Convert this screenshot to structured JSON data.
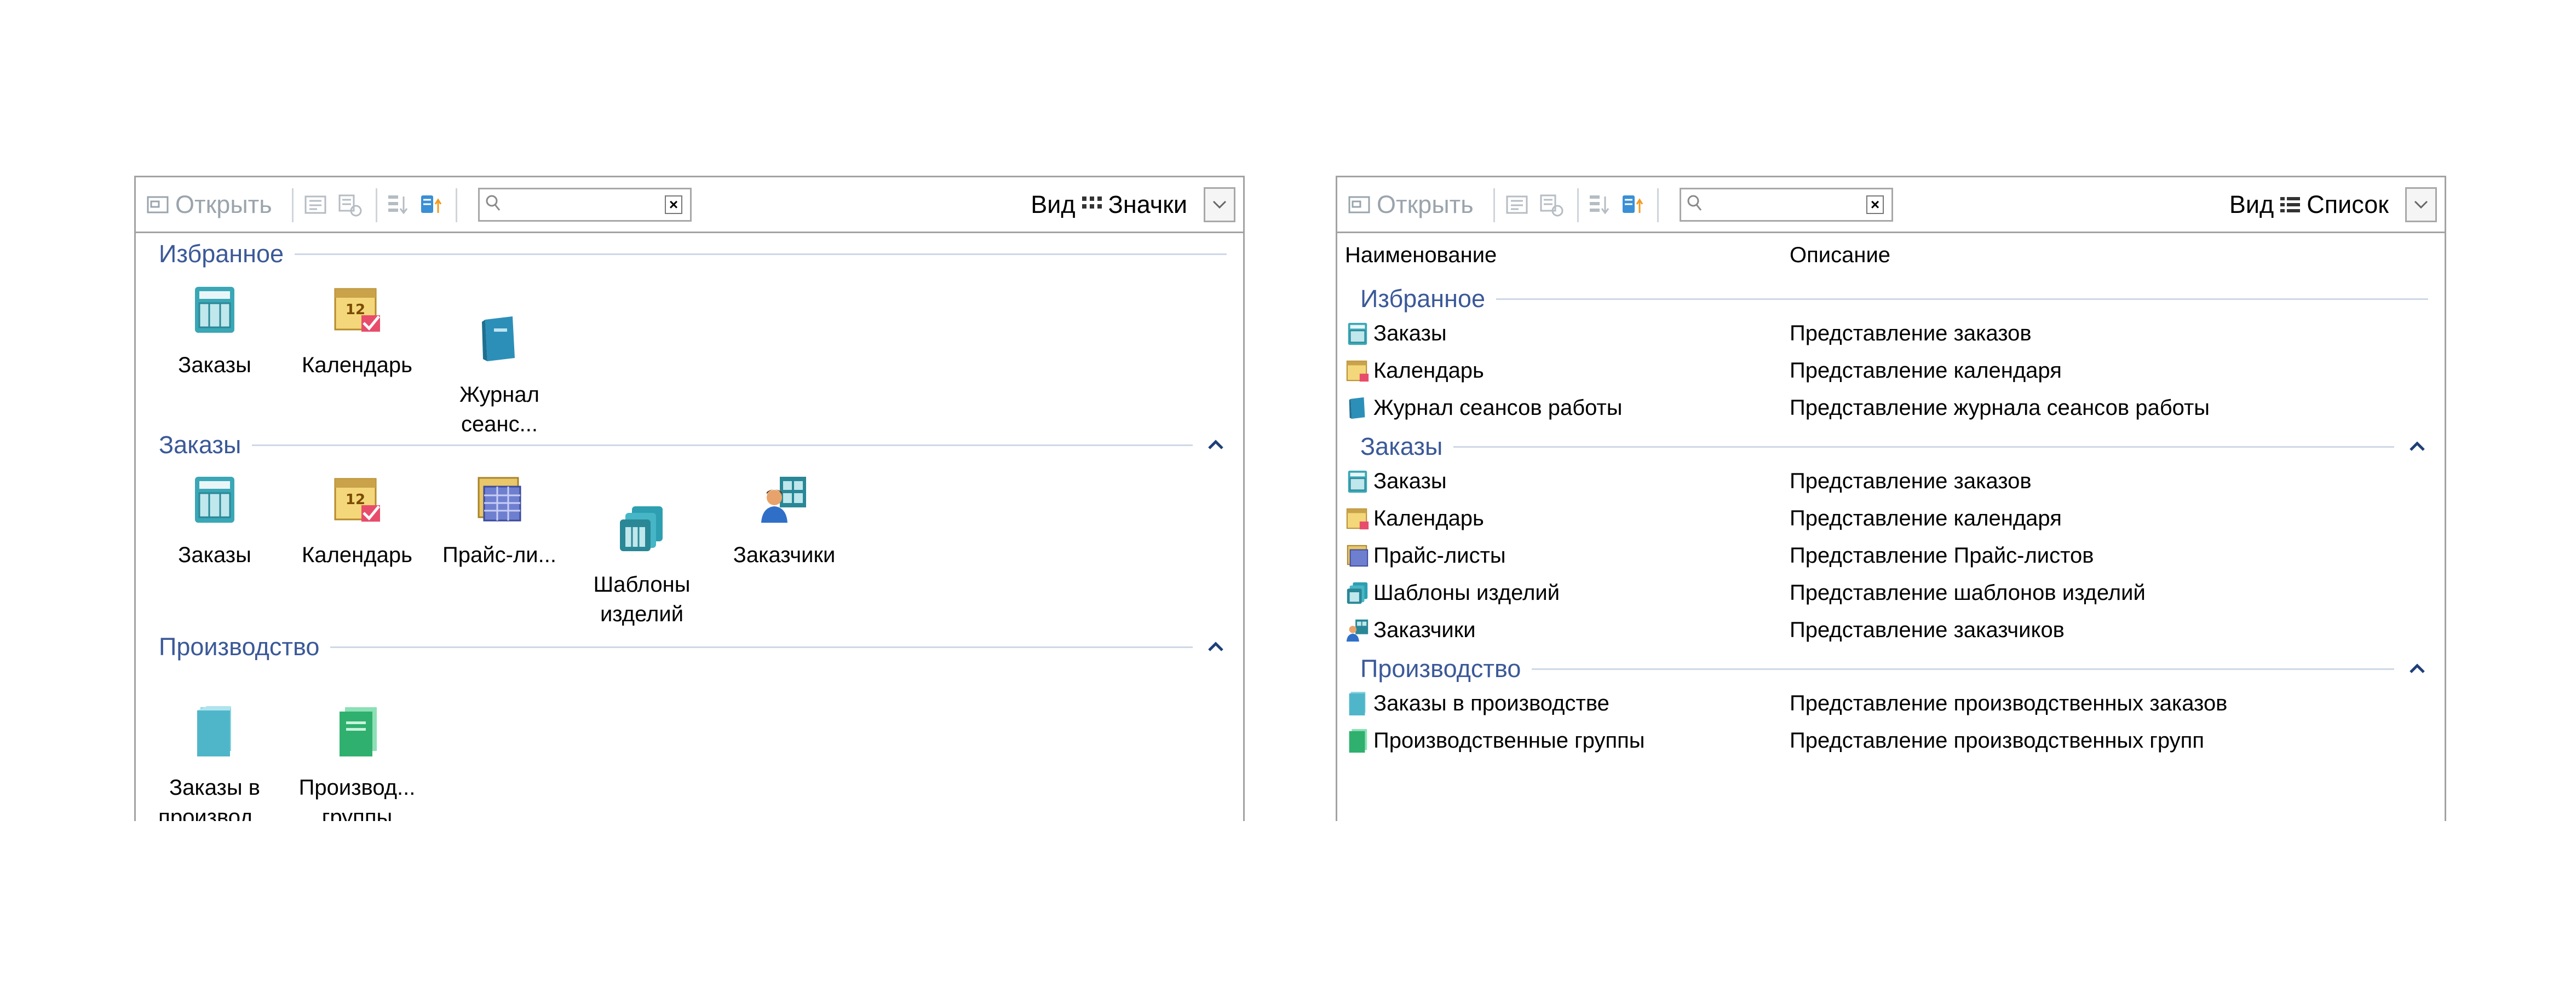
{
  "toolbar": {
    "open_label": "Открыть",
    "view_label": "Вид",
    "search_placeholder": ""
  },
  "left_panel": {
    "view_value": "Значки",
    "groups": [
      {
        "title": "Избранное",
        "items": [
          {
            "label": "Заказы",
            "icon": "orders-icon"
          },
          {
            "label": "Календарь",
            "icon": "calendar-icon"
          },
          {
            "label": "Журнал\nсеанс...",
            "icon": "journal-icon"
          }
        ]
      },
      {
        "title": "Заказы",
        "items": [
          {
            "label": "Заказы",
            "icon": "orders-icon"
          },
          {
            "label": "Календарь",
            "icon": "calendar-icon"
          },
          {
            "label": "Прайс-ли...",
            "icon": "price-list-icon"
          },
          {
            "label": "Шаблоны\nизделий",
            "icon": "templates-icon"
          },
          {
            "label": "Заказчики",
            "icon": "customers-icon"
          }
        ]
      },
      {
        "title": "Производство",
        "items": [
          {
            "label": "Заказы в\nпроизвод...",
            "icon": "production-orders-icon"
          },
          {
            "label": "Производ...\nгруппы",
            "icon": "production-groups-icon"
          }
        ]
      }
    ]
  },
  "right_panel": {
    "view_value": "Список",
    "columns": [
      "Наименование",
      "Описание"
    ],
    "groups": [
      {
        "title": "Избранное",
        "rows": [
          {
            "name": "Заказы",
            "desc": "Представление заказов",
            "icon": "orders-icon"
          },
          {
            "name": "Календарь",
            "desc": "Представление календаря",
            "icon": "calendar-icon"
          },
          {
            "name": "Журнал сеансов работы",
            "desc": "Представление журнала сеансов работы",
            "icon": "journal-icon"
          }
        ]
      },
      {
        "title": "Заказы",
        "rows": [
          {
            "name": "Заказы",
            "desc": "Представление заказов",
            "icon": "orders-icon"
          },
          {
            "name": "Календарь",
            "desc": "Представление календаря",
            "icon": "calendar-icon"
          },
          {
            "name": "Прайс-листы",
            "desc": "Представление Прайс-листов",
            "icon": "price-list-icon"
          },
          {
            "name": "Шаблоны изделий",
            "desc": "Представление шаблонов изделий",
            "icon": "templates-icon"
          },
          {
            "name": "Заказчики",
            "desc": "Представление заказчиков",
            "icon": "customers-icon"
          }
        ]
      },
      {
        "title": "Производство",
        "rows": [
          {
            "name": "Заказы в производстве",
            "desc": "Представление производственных заказов",
            "icon": "production-orders-icon"
          },
          {
            "name": "Производственные группы",
            "desc": "Представление производственных групп",
            "icon": "production-groups-icon"
          }
        ]
      }
    ]
  }
}
